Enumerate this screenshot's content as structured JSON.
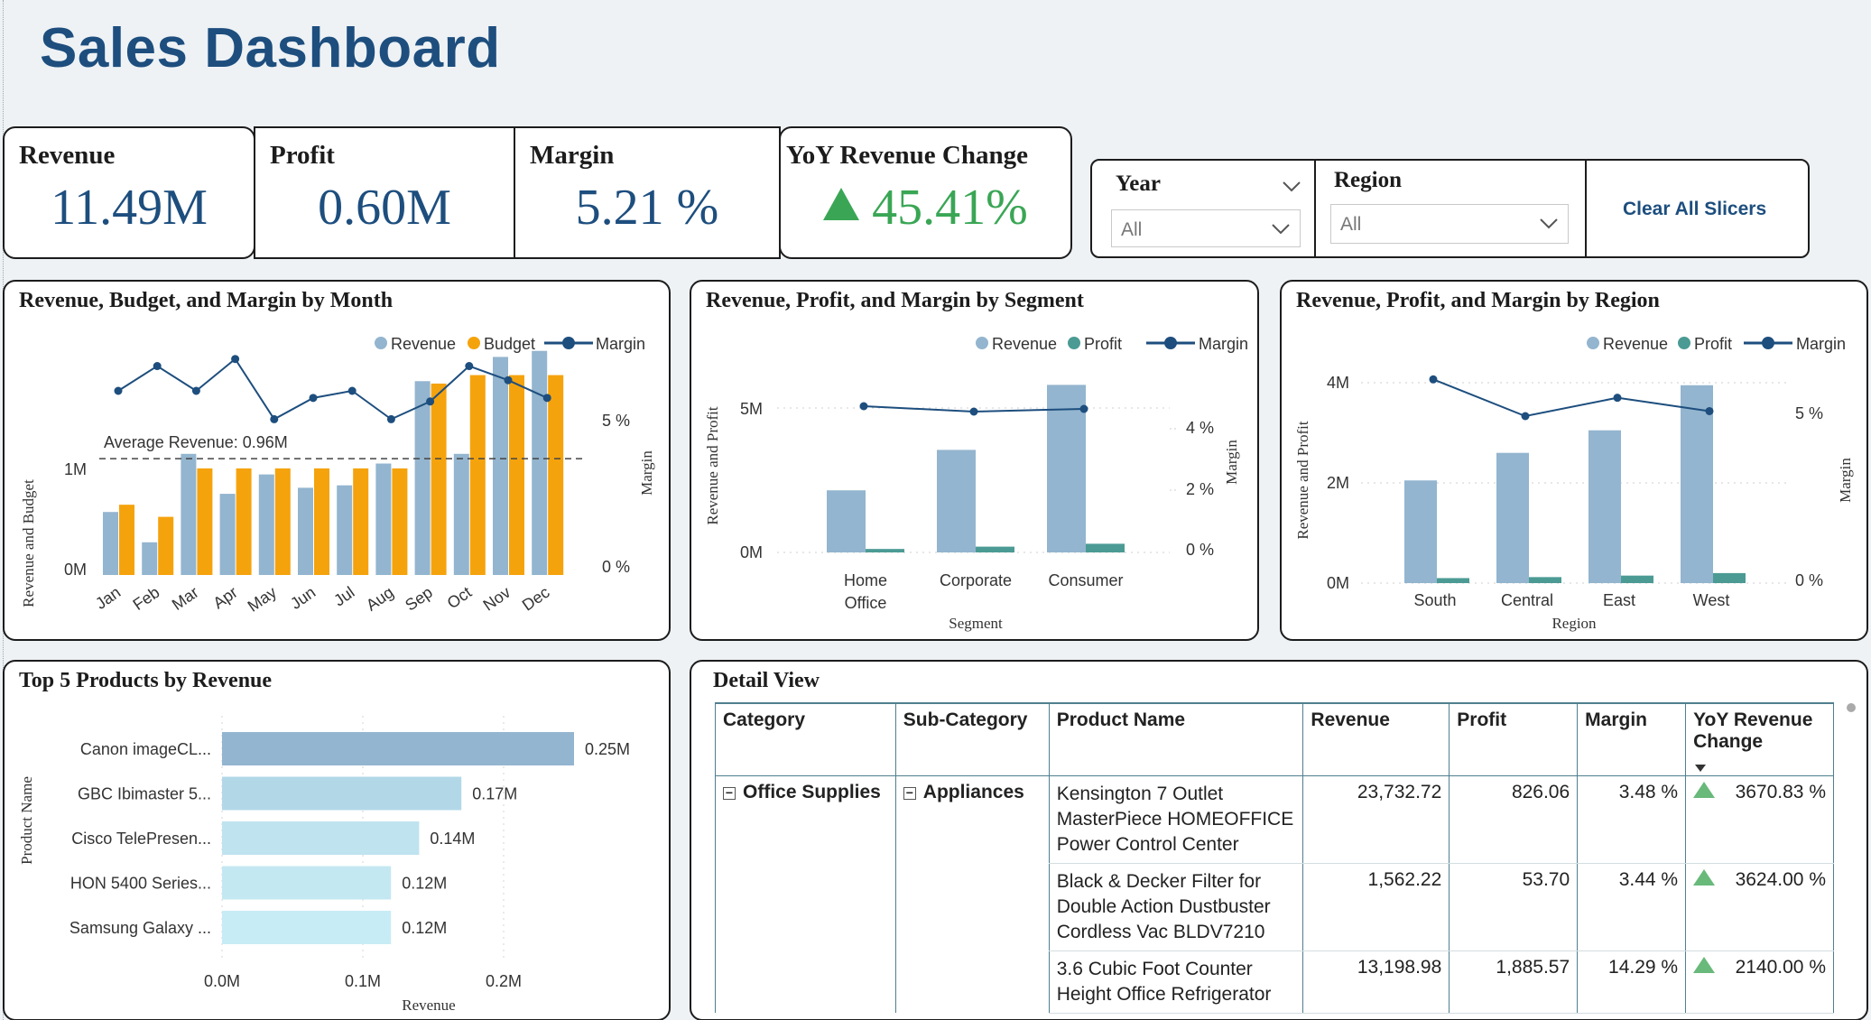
{
  "page_title": "Sales Dashboard",
  "kpis": [
    {
      "label": "Revenue",
      "value": "11.49M"
    },
    {
      "label": "Profit",
      "value": "0.60M"
    },
    {
      "label": "Margin",
      "value": "5.21 %"
    },
    {
      "label": "YoY Revenue Change",
      "value": "45.41%"
    }
  ],
  "colors": {
    "kpi_value": "#1d4e7e",
    "positive": "#3aa655",
    "revenue": "#93b5cf",
    "budget": "#f5a30c",
    "profit": "#4b9b94",
    "margin": "#1d4e7e"
  },
  "slicers": {
    "year": {
      "label": "Year",
      "value": "All"
    },
    "region": {
      "label": "Region",
      "value": "All"
    },
    "clear_label": "Clear All Slicers"
  },
  "month_chart": {
    "title": "Revenue, Budget, and Margin by Month",
    "ylabel_left": "Revenue and Budget",
    "ylabel_right": "Margin",
    "left_ticks": [
      "0M",
      "1M"
    ],
    "right_ticks": [
      "0 %",
      "5 %"
    ],
    "legend": [
      "Revenue",
      "Budget",
      "Margin"
    ],
    "average_label": "Average Revenue: 0.96M"
  },
  "segment_chart": {
    "title": "Revenue, Profit, and Margin by Segment",
    "ylabel_left": "Revenue and Profit",
    "ylabel_right": "Margin",
    "xlabel": "Segment",
    "left_ticks": [
      "0M",
      "5M"
    ],
    "right_ticks": [
      "0 %",
      "2 %",
      "4 %"
    ],
    "legend": [
      "Revenue",
      "Profit",
      "Margin"
    ],
    "cat_home_line1": "Home",
    "cat_home_line2": "Office",
    "cat_corporate": "Corporate",
    "cat_consumer": "Consumer"
  },
  "region_chart": {
    "title": "Revenue, Profit, and Margin by Region",
    "ylabel_left": "Revenue and Profit",
    "ylabel_right": "Margin",
    "xlabel": "Region",
    "left_ticks": [
      "0M",
      "2M",
      "4M"
    ],
    "right_ticks": [
      "0 %",
      "5 %"
    ],
    "legend": [
      "Revenue",
      "Profit",
      "Margin"
    ]
  },
  "products_chart": {
    "title": "Top 5 Products by Revenue",
    "ylabel": "Product Name",
    "xlabel": "Revenue",
    "x_ticks": [
      "0.0M",
      "0.1M",
      "0.2M"
    ]
  },
  "chart_data": [
    {
      "type": "bar",
      "title": "Revenue, Budget, and Margin by Month",
      "categories": [
        "Jan",
        "Feb",
        "Mar",
        "Apr",
        "May",
        "Jun",
        "Jul",
        "Aug",
        "Sep",
        "Oct",
        "Nov",
        "Dec"
      ],
      "series": [
        {
          "name": "Revenue",
          "values": [
            0.52,
            0.27,
            1.0,
            0.67,
            0.83,
            0.72,
            0.74,
            0.92,
            1.6,
            1.0,
            1.8,
            1.85
          ]
        },
        {
          "name": "Budget",
          "values": [
            0.58,
            0.48,
            0.88,
            0.88,
            0.88,
            0.88,
            0.88,
            0.88,
            1.58,
            1.65,
            1.65,
            1.65
          ]
        },
        {
          "name": "Margin",
          "values": [
            5.2,
            5.9,
            5.2,
            6.1,
            4.4,
            5.0,
            5.2,
            4.4,
            4.9,
            5.9,
            5.5,
            5.0
          ]
        }
      ],
      "ylim_left": [
        0,
        1.9
      ],
      "ylim_right": [
        0,
        6.5
      ],
      "average_revenue": 0.96,
      "ylabel": "Revenue and Budget",
      "y2label": "Margin"
    },
    {
      "type": "bar",
      "title": "Revenue, Profit, and Margin by Segment",
      "categories": [
        "Home Office",
        "Corporate",
        "Consumer"
      ],
      "series": [
        {
          "name": "Revenue",
          "values": [
            2.15,
            3.55,
            5.8
          ]
        },
        {
          "name": "Profit",
          "values": [
            0.12,
            0.2,
            0.3
          ]
        },
        {
          "name": "Margin",
          "values": [
            5.3,
            5.2,
            5.25
          ]
        }
      ],
      "ylim_left": [
        0,
        6
      ],
      "ylim_right": [
        0,
        5.8
      ],
      "xlabel": "Segment",
      "ylabel": "Revenue and Profit",
      "y2label": "Margin"
    },
    {
      "type": "bar",
      "title": "Revenue, Profit, and Margin by Region",
      "categories": [
        "South",
        "Central",
        "East",
        "West"
      ],
      "series": [
        {
          "name": "Revenue",
          "values": [
            2.05,
            2.6,
            3.05,
            3.95
          ]
        },
        {
          "name": "Profit",
          "values": [
            0.1,
            0.12,
            0.15,
            0.2
          ]
        },
        {
          "name": "Margin",
          "values": [
            6.1,
            5.0,
            5.55,
            5.15
          ]
        }
      ],
      "ylim_left": [
        0,
        4.4
      ],
      "ylim_right": [
        0,
        8
      ],
      "xlabel": "Region",
      "ylabel": "Revenue and Profit",
      "y2label": "Margin"
    },
    {
      "type": "bar",
      "orientation": "horizontal",
      "title": "Top 5 Products by Revenue",
      "categories": [
        "Canon imageCL...",
        "GBC Ibimaster 5...",
        "Cisco TelePresen...",
        "HON 5400 Series...",
        "Samsung Galaxy ..."
      ],
      "values": [
        0.25,
        0.17,
        0.14,
        0.12,
        0.12
      ],
      "value_labels": [
        "0.25M",
        "0.17M",
        "0.14M",
        "0.12M",
        "0.12M"
      ],
      "xlim": [
        0,
        0.25
      ],
      "xlabel": "Revenue",
      "ylabel": "Product Name"
    }
  ],
  "detail": {
    "title": "Detail View",
    "columns": [
      "Category",
      "Sub-Category",
      "Product Name",
      "Revenue",
      "Profit",
      "Margin",
      "YoY Revenue Change"
    ],
    "category": "Office Supplies",
    "subcategory": "Appliances",
    "rows": [
      {
        "product": "Kensington 7 Outlet MasterPiece HOMEOFFICE Power Control Center",
        "revenue": "23,732.72",
        "profit": "826.06",
        "margin": "3.48 %",
        "yoy": "3670.83 %"
      },
      {
        "product": "Black & Decker Filter for Double Action Dustbuster Cordless Vac BLDV7210",
        "revenue": "1,562.22",
        "profit": "53.70",
        "margin": "3.44 %",
        "yoy": "3624.00 %"
      },
      {
        "product": "3.6 Cubic Foot Counter Height Office Refrigerator",
        "revenue": "13,198.98",
        "profit": "1,885.57",
        "margin": "14.29 %",
        "yoy": "2140.00 %"
      }
    ]
  }
}
